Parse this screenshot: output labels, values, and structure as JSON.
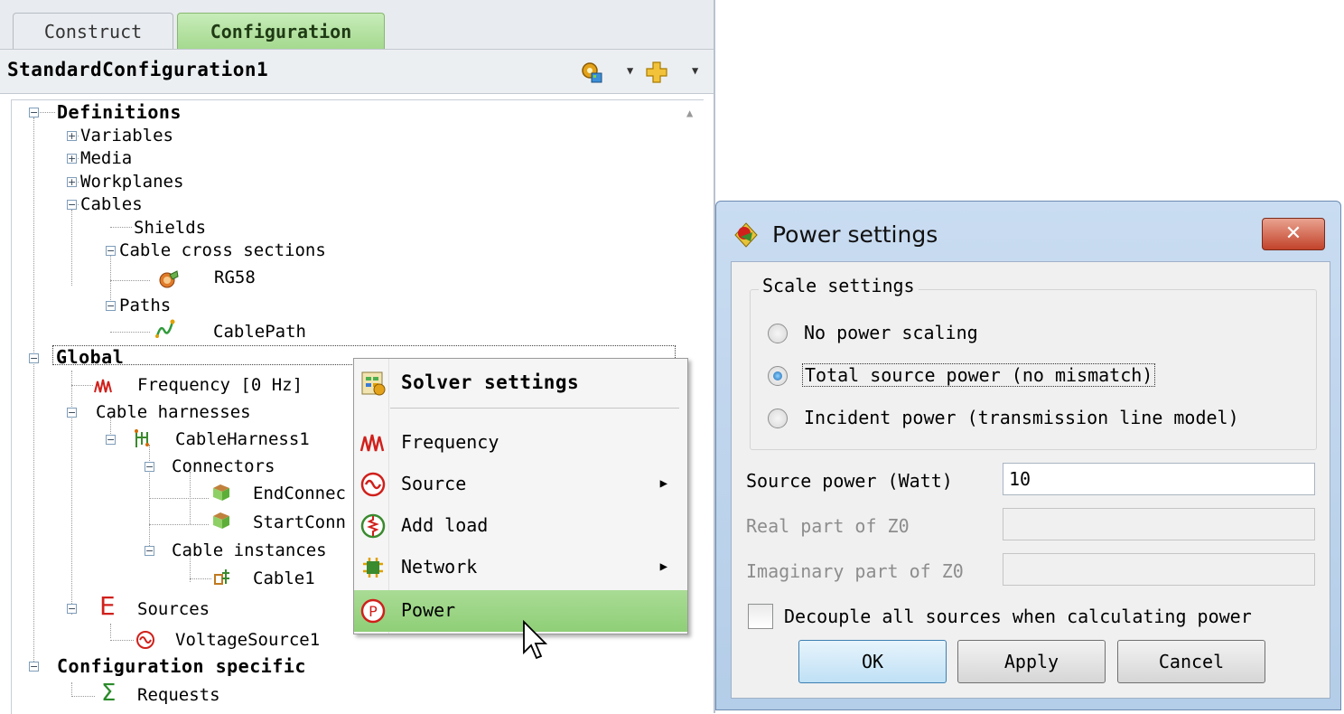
{
  "left_panel": {
    "tabs": [
      "Construct",
      "Configuration"
    ],
    "configuration_title": "StandardConfiguration1",
    "tree": {
      "definitions": "Definitions",
      "variables": "Variables",
      "media": "Media",
      "workplanes": "Workplanes",
      "cables": "Cables",
      "shields": "Shields",
      "cable_cross_sections": "Cable cross sections",
      "rg58": "RG58",
      "paths": "Paths",
      "cable_path": "CablePath",
      "global": "Global",
      "frequency": "Frequency [0 Hz]",
      "cable_harnesses": "Cable harnesses",
      "cable_harness1": "CableHarness1",
      "connectors": "Connectors",
      "end_connector": "EndConnec",
      "start_connector": "StartConn",
      "cable_instances": "Cable instances",
      "cable1": "Cable1",
      "sources": "Sources",
      "voltage_source1": "VoltageSource1",
      "configuration_specific": "Configuration specific",
      "requests": "Requests"
    }
  },
  "context_menu": {
    "solver_settings": "Solver settings",
    "frequency": "Frequency",
    "source": "Source",
    "add_load": "Add load",
    "network": "Network",
    "power": "Power"
  },
  "dialog": {
    "title": "Power settings",
    "scale_group_label": "Scale settings",
    "options": [
      "No power scaling",
      "Total source power (no mismatch)",
      "Incident power (transmission line model)"
    ],
    "selected_option_index": 1,
    "source_power_label": "Source power (Watt)",
    "source_power_value": "10",
    "real_z0_label": "Real part of Z0",
    "real_z0_value": "",
    "imag_z0_label": "Imaginary part of Z0",
    "imag_z0_value": "",
    "decouple_label": "Decouple all sources when calculating power",
    "decouple_checked": false,
    "buttons": {
      "ok": "OK",
      "apply": "Apply",
      "cancel": "Cancel"
    }
  },
  "colors": {
    "active_tab": "#a5d98f",
    "menu_highlight": "#8fcf77",
    "dialog_frame": "#b4cde8",
    "close_button": "#c2422a"
  }
}
